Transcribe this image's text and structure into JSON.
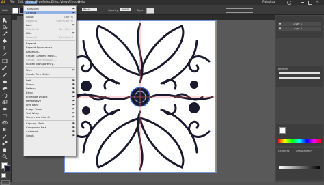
{
  "menubar": {
    "logo": "Ai",
    "items": [
      "File",
      "Edit",
      "Object",
      "Type",
      "Select",
      "Effect",
      "View",
      "Window",
      "Help"
    ],
    "workspace": "Painting"
  },
  "control_bar": {
    "selection": "Path",
    "stroke_label": "Stroke:",
    "stroke_value": "1 pt",
    "brush_value": "Basic",
    "opacity_label": "Opacity:",
    "opacity_value": "100%",
    "style_label": "Style:"
  },
  "object_menu": {
    "items": [
      {
        "label": "Transform",
        "submenu": true
      },
      {
        "label": "Arrange",
        "submenu": true,
        "highlighted": true
      },
      {
        "label": "Group",
        "shortcut": "Ctrl+G"
      },
      {
        "label": "Ungroup",
        "shortcut": "Shift+Ctrl+G",
        "disabled": true
      },
      {
        "label": "Lock",
        "submenu": true
      },
      {
        "label": "Unlock All",
        "shortcut": "Alt+Ctrl+2",
        "disabled": true
      },
      {
        "label": "Hide",
        "submenu": true
      },
      {
        "label": "Show All",
        "shortcut": "Alt+Ctrl+3",
        "disabled": true
      },
      {
        "separator": true
      },
      {
        "label": "Expand..."
      },
      {
        "label": "Expand Appearance"
      },
      {
        "label": "Rasterize..."
      },
      {
        "label": "Create Gradient Mesh..."
      },
      {
        "label": "Create Object Mosaic...",
        "disabled": true
      },
      {
        "label": "Flatten Transparency..."
      },
      {
        "separator": true
      },
      {
        "label": "Slice",
        "submenu": true
      },
      {
        "label": "Create Trim Marks"
      },
      {
        "separator": true
      },
      {
        "label": "Path",
        "submenu": true
      },
      {
        "label": "Shape",
        "submenu": true
      },
      {
        "label": "Pattern",
        "submenu": true
      },
      {
        "label": "Blend",
        "submenu": true
      },
      {
        "label": "Envelope Distort",
        "submenu": true
      },
      {
        "label": "Perspective",
        "submenu": true
      },
      {
        "label": "Live Paint",
        "submenu": true
      },
      {
        "label": "Image Trace",
        "submenu": true
      },
      {
        "label": "Text Wrap",
        "submenu": true
      },
      {
        "label": "Sketch and Line Art",
        "submenu": true
      },
      {
        "separator": true
      },
      {
        "label": "Clipping Mask",
        "submenu": true
      },
      {
        "label": "Compound Path",
        "submenu": true
      },
      {
        "label": "Artboards",
        "submenu": true
      },
      {
        "label": "Graph",
        "submenu": true
      }
    ]
  },
  "layers_panel": {
    "layers": [
      "Layer 1",
      "Layer 2"
    ]
  },
  "brushes_panel": {
    "title": "Brushes"
  },
  "gradient_panel": {
    "tabs": [
      "Gradient",
      "Transparency"
    ]
  },
  "colors": {
    "accent": "#8fb3e6",
    "art_stroke": "#1a1a2e",
    "art_highlight": "#3b6bd6"
  }
}
